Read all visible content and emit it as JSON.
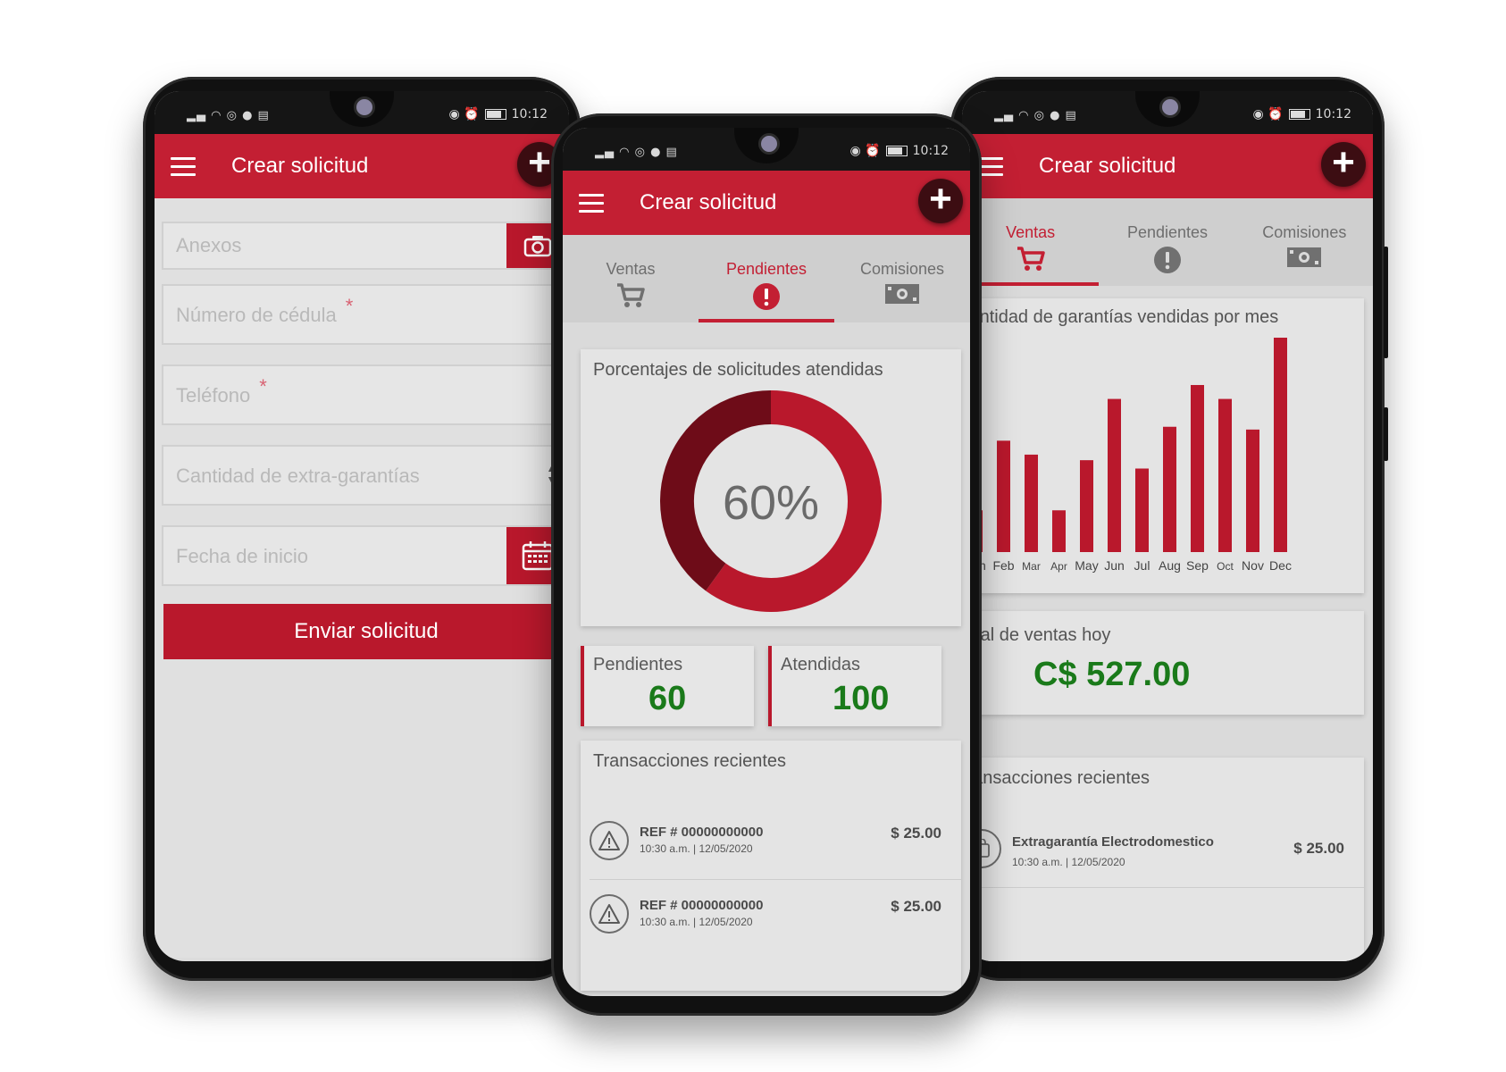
{
  "status": {
    "time": "10:12"
  },
  "appbar": {
    "title": "Crear solicitud"
  },
  "form": {
    "anexos": "Anexos",
    "cedula": "Número de cédula",
    "telefono": "Teléfono",
    "extra": "Cantidad de extra-garantías",
    "fecha": "Fecha de inicio",
    "required": "*",
    "submit": "Enviar solicitud"
  },
  "tabs": [
    "Ventas",
    "Pendientes",
    "Comisiones"
  ],
  "pendientes": {
    "chart_title": "Porcentajes de solicitudes atendidas",
    "percent_label": "60%",
    "stats": [
      {
        "label": "Pendientes",
        "value": "60"
      },
      {
        "label": "Atendidas",
        "value": "100"
      }
    ],
    "recent_title": "Transacciones recientes",
    "transactions": [
      {
        "ref": "REF # 00000000000",
        "date": "10:30 a.m. | 12/05/2020",
        "amount": "$ 25.00"
      },
      {
        "ref": "REF # 00000000000",
        "date": "10:30 a.m. | 12/05/2020",
        "amount": "$ 25.00"
      }
    ]
  },
  "ventas": {
    "total_label": "Total de ventas hoy",
    "total_value": "C$ 527.00",
    "recent_title": "Transacciones recientes",
    "transaction": {
      "name": "Extragarantía Electrodomestico",
      "date": "10:30 a.m. | 12/05/2020",
      "amount": "$ 25.00"
    }
  },
  "chart_data": [
    {
      "type": "pie",
      "title": "Porcentajes de solicitudes atendidas",
      "categories": [
        "Atendidas",
        "Pendientes"
      ],
      "values": [
        60,
        40
      ],
      "center_label": "60%",
      "colors": [
        "#b9182c",
        "#6e0c18"
      ]
    },
    {
      "type": "bar",
      "title": "Cantidad de garantías vendidas por mes",
      "categories": [
        "Jan",
        "Feb",
        "Mar",
        "Apr",
        "May",
        "Jun",
        "Jul",
        "Aug",
        "Sep",
        "Oct",
        "Nov",
        "Dec"
      ],
      "values": [
        3,
        8,
        7,
        3,
        6.6,
        11,
        6,
        9,
        12,
        11,
        8.8,
        15.4
      ],
      "ylim": [
        0,
        15.4
      ],
      "color": "#b9182c"
    }
  ]
}
